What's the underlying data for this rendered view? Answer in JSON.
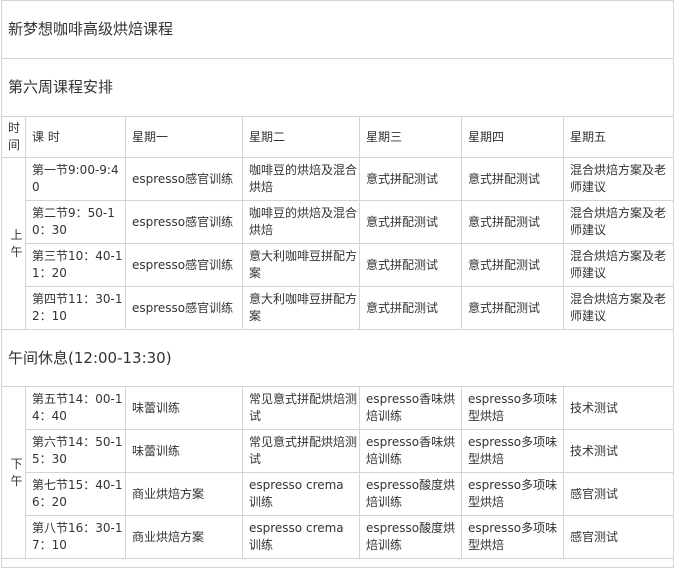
{
  "page": {
    "title": "新梦想咖啡高级烘焙课程",
    "week_title": "第六周课程安排",
    "break_text": "午间休息(12:00-13:30)"
  },
  "table": {
    "headers": [
      "时间",
      "课 时",
      "星期一",
      "星期二",
      "星期三",
      "星期四",
      "星期五"
    ],
    "morning": {
      "label": "上午",
      "rows": [
        [
          "第一节9:00-9:40",
          "espresso感官训练",
          "咖啡豆的烘焙及混合烘焙",
          "意式拼配测试",
          "意式拼配测试",
          "混合烘焙方案及老师建议"
        ],
        [
          "第二节9：50-10：30",
          "espresso感官训练",
          "咖啡豆的烘焙及混合烘焙",
          "意式拼配测试",
          "意式拼配测试",
          "混合烘焙方案及老师建议"
        ],
        [
          "第三节10：40-11：20",
          "espresso感官训练",
          "意大利咖啡豆拼配方案",
          "意式拼配测试",
          "意式拼配测试",
          "混合烘焙方案及老师建议"
        ],
        [
          "第四节11：30-12：10",
          "espresso感官训练",
          "意大利咖啡豆拼配方案",
          "意式拼配测试",
          "意式拼配测试",
          "混合烘焙方案及老师建议"
        ]
      ]
    },
    "afternoon": {
      "label": "下午",
      "rows": [
        [
          "第五节14：00-14：40",
          "味蕾训练",
          "常见意式拼配烘焙测试",
          "espresso香味烘焙训练",
          "espresso多项味型烘焙",
          "技术测试"
        ],
        [
          "第六节14：50-15：30",
          "味蕾训练",
          "常见意式拼配烘焙测试",
          "espresso香味烘焙训练",
          "espresso多项味型烘焙",
          "技术测试"
        ],
        [
          "第七节15：40-16：20",
          "商业烘焙方案",
          "espresso crema 训练",
          "espresso酸度烘焙训练",
          "espresso多项味型烘焙",
          "感官测试"
        ],
        [
          "第八节16：30-17：10",
          "商业烘焙方案",
          "espresso crema 训练",
          "espresso酸度烘焙训练",
          "espresso多项味型烘焙",
          "感官测试"
        ]
      ]
    }
  }
}
